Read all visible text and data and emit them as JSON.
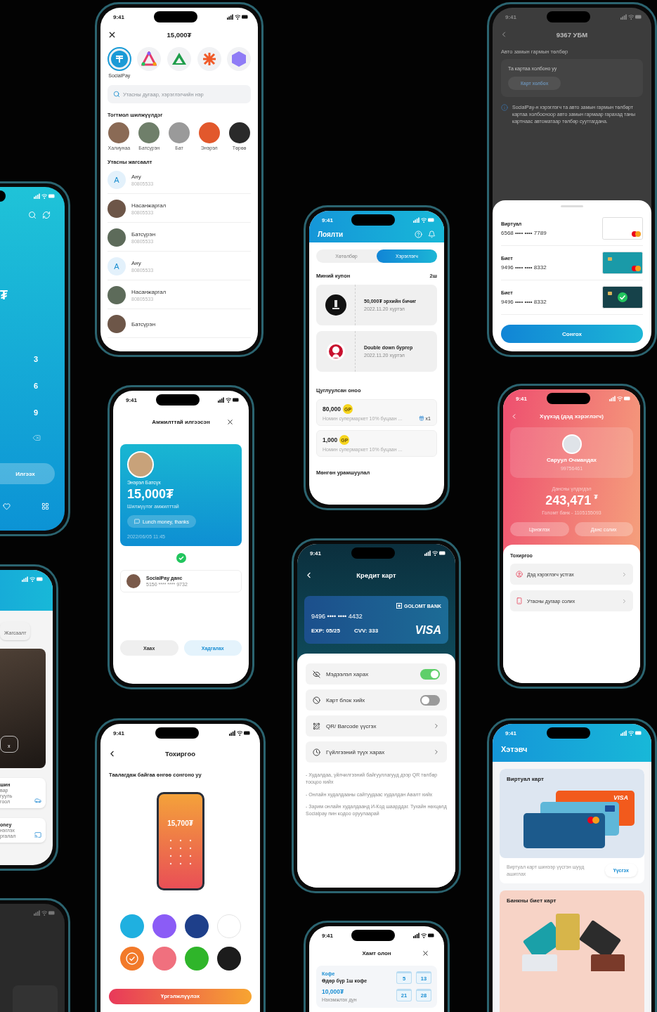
{
  "transfer": {
    "time": "9:41",
    "amount": "15,000₮",
    "apps": [
      {
        "label": "SocialPay",
        "selected": true
      },
      {
        "selected": false
      },
      {
        "selected": false
      },
      {
        "selected": false
      },
      {
        "selected": false
      }
    ],
    "search_placeholder": "Утасны дугаар, хэрэглэгчийн нэр",
    "frequent_title": "Тогтмол шилжүүлдэг",
    "frequent": [
      "Халиунаа",
      "Батсүрэн",
      "Бат",
      "Энэрэл",
      "Төрөө"
    ],
    "contacts_title": "Утасны жагсаалт",
    "contacts": [
      {
        "kind": "initial",
        "initial": "А",
        "name": "Ану",
        "phone": "80805533"
      },
      {
        "kind": "photo",
        "name": "Насанжаргал",
        "phone": "80805533"
      },
      {
        "kind": "photo",
        "name": "Батсүрэн",
        "phone": "80805533"
      },
      {
        "kind": "initial",
        "initial": "А",
        "name": "Ану",
        "phone": "80805533"
      },
      {
        "kind": "photo",
        "name": "Насанжаргал",
        "phone": "80805533"
      },
      {
        "kind": "photo",
        "name": "Батсүрэн"
      }
    ]
  },
  "vehicle": {
    "time": "9:41",
    "title": "9367 УБМ",
    "section": "Авто замын гармын төлбөр",
    "prompt": "Та картаа холбоно уу",
    "link_button": "Карт холбох",
    "info": "SocialPay-н хэрэглэгч та авто замын гармын төлбөрт картаа холбосноор авто замын гармаар гарахад таны картнаас автоматаар төлбөр суутгагдана.",
    "cards": [
      {
        "kind": "white",
        "type": "Виртуал",
        "number": "6568 •••• •••• 7789",
        "selected": false
      },
      {
        "kind": "teal",
        "type": "Биет",
        "number": "9496 •••• •••• 8332",
        "selected": false
      },
      {
        "kind": "dark",
        "type": "Биет",
        "number": "9496 •••• •••• 8332",
        "selected": true
      }
    ],
    "button": "Сонгох"
  },
  "keypad": {
    "currency": "₮",
    "keys": [
      "3",
      "6",
      "9"
    ],
    "send_button": "Илгээх"
  },
  "loyalty": {
    "time": "9:41",
    "title": "Лоялти",
    "tabs": [
      {
        "label": "Хөтөлбөр",
        "selected": false
      },
      {
        "label": "Хэрэглэгч",
        "selected": true
      }
    ],
    "coupons_title": "Миний купон",
    "coupons_count": "2ш",
    "coupons": [
      {
        "kind": "dark",
        "title": "50,000₮ эрхийн бичиг",
        "date": "2022.11.20 хүртэл"
      },
      {
        "kind": "red",
        "title": "Double down бургер",
        "date": "2022.11.20 хүртэл"
      }
    ],
    "points_title": "Цуглуулсан оноо",
    "points": [
      {
        "amount": "80,000",
        "badge": "GP",
        "desc": "Номин супермаркет 10% буцаан ...",
        "gift": "x1"
      },
      {
        "amount": "1,000",
        "badge": "GP",
        "desc": "Номин супермаркет 10% буцаан ..."
      }
    ],
    "promo_title": "Мөнгөн урамшуулал"
  },
  "list_partial": {
    "tab": "Жагсаалт",
    "chip": "x",
    "cards": [
      {
        "title": "шин",
        "lines": [
          "вар",
          "гуүль",
          "гоол"
        ]
      },
      {
        "title": "oney",
        "lines": [
          "нэглэх",
          "ргалал"
        ]
      }
    ]
  },
  "success": {
    "time": "9:41",
    "title": "Амжилттай илгээсэн",
    "name": "Энэрэл Батсүх",
    "amount": "15,000₮",
    "status": "Шилжүүлэг амжилттай",
    "note": "Lunch money, thanks",
    "date": "2022/06/05 11:45",
    "account_name": "SocialPay данс",
    "account_number": "5150 **** **** 9732",
    "buttons": [
      "Хаах",
      "Хадгалах"
    ]
  },
  "child": {
    "time": "9:41",
    "title": "Хүүхэд (дэд хэрэглэгч)",
    "name": "Саруул Очмандах",
    "phone": "99756461",
    "balance_label": "Дансны үлдэгдэл",
    "balance": "243,471",
    "currency": "₮",
    "bank": "Голомт банк - 1105155093",
    "actions": [
      "Цэнэглэх",
      "Данс солих"
    ],
    "settings_title": "Тохиргоо",
    "settings": [
      {
        "kind": "user",
        "label": "Дэд хэрэглэгч устгах"
      },
      {
        "kind": "phone",
        "label": "Утасны дугаар солих"
      }
    ]
  },
  "credit": {
    "time": "9:41",
    "title": "Кредит карт",
    "bank": "GOLOMT BANK",
    "number": "9496 •••• •••• 4432",
    "exp": "EXP: 05/25",
    "cvv": "CVV: 333",
    "brand": "VISA",
    "options": [
      {
        "kind": "toggle",
        "label": "Мэдээлэл харах",
        "on": true
      },
      {
        "kind": "toggle",
        "label": "Карт блок хийх",
        "on": false
      },
      {
        "kind": "link",
        "label": "QR/ Barcode үүсгэх"
      },
      {
        "kind": "link",
        "label": "Гүйлгээний түүх харах"
      }
    ],
    "notes": [
      "- Худалдаа, үйлчилгээний байгууллагууд дээр QR төлбөр тооцоо хийх",
      "- Онлайн худалдааны сайтуудаас худалдан Авалт хийх",
      "- Зарим онлайн худалдаанд И-Код шаарддаг. Тухайн нөхцөлд Socialpay пин кодоо оруулаарай"
    ]
  },
  "theme": {
    "time": "9:41",
    "title": "Тохиргоо",
    "prompt": "Таалагдаж байгаа өнгөө сонгоно уу",
    "preview_amount": "15,700₮",
    "colors": [
      {
        "color": "#1fb0e0",
        "selected": false
      },
      {
        "color": "#8b5cf6",
        "selected": false
      },
      {
        "color": "#1e3f8a",
        "selected": false
      },
      {
        "color": "#ffffff",
        "selected": false
      },
      {
        "color": "#f27a2a",
        "selected": true
      },
      {
        "color": "#f0707e",
        "selected": false
      },
      {
        "color": "#2fb52a",
        "selected": false
      },
      {
        "color": "#1c1c1c",
        "selected": false
      }
    ],
    "button": "Үргэлжлүүлэх"
  },
  "team": {
    "time": "9:41",
    "title": "Хамт олон",
    "name": "Кофе",
    "desc": "Өдөр бүр 1ш кофе",
    "amount": "10,000₮",
    "amount_label": "Нэхэмжлэх дүн",
    "days": [
      "5",
      "13",
      "21",
      "28"
    ]
  },
  "wallet": {
    "time": "9:41",
    "title": "Хэтэвч",
    "virtual_title": "Виртуал карт",
    "virtual_brand": "VISA",
    "virtual_desc": "Виртуал карт шинээр үүсгэн шууд ашиглах",
    "create_button": "Үүсгэх",
    "physical_title": "Банкны биет карт"
  }
}
